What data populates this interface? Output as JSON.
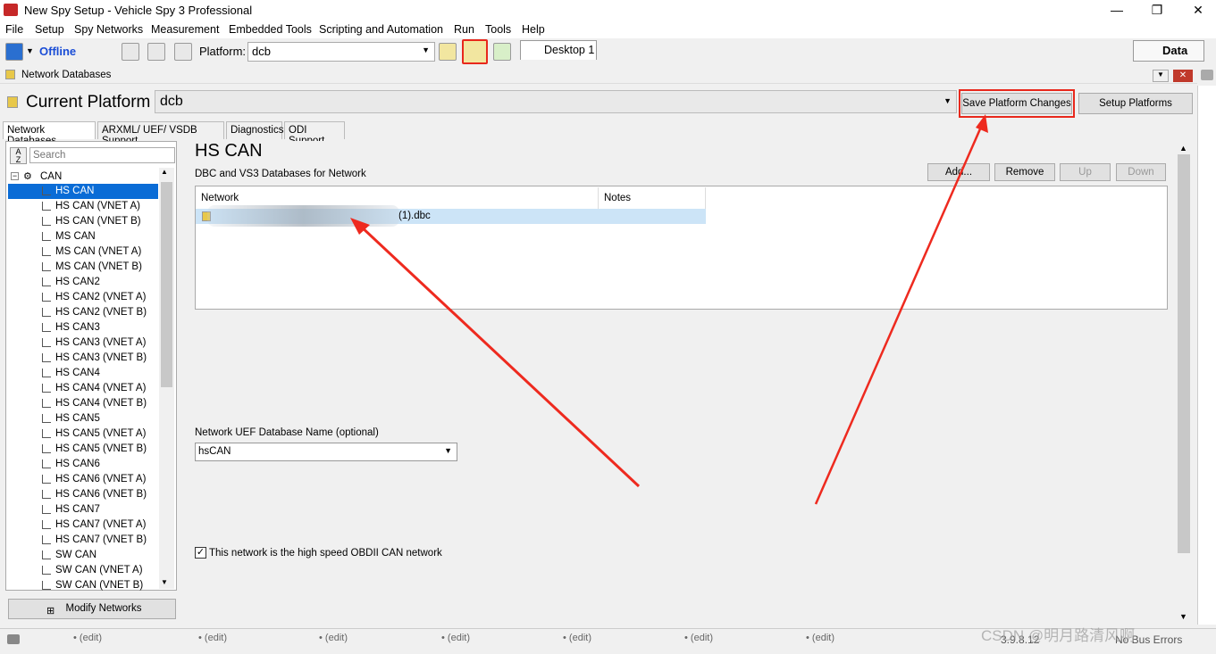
{
  "window": {
    "title": "New Spy Setup - Vehicle Spy 3 Professional",
    "minimize": "—",
    "maximize": "❐",
    "close": "✕"
  },
  "menu": [
    "File",
    "Setup",
    "Spy Networks",
    "Measurement",
    "Embedded Tools",
    "Scripting and Automation",
    "Run",
    "Tools",
    "Help"
  ],
  "toolbar": {
    "status": "Offline",
    "platform_label": "Platform:",
    "platform_value": "dcb",
    "desktop_tab": "Desktop 1",
    "data_button": "Data"
  },
  "panel": {
    "title": "Network Databases"
  },
  "current_platform": {
    "label": "Current Platform",
    "value": "dcb",
    "save_button": "Save Platform Changes",
    "setup_button": "Setup Platforms"
  },
  "tabs": [
    "Network Databases",
    "ARXML/ UEF/ VSDB Support",
    "Diagnostics",
    "ODI Support"
  ],
  "tree": {
    "search_placeholder": "Search",
    "root": "CAN",
    "items": [
      "HS CAN",
      "HS CAN (VNET A)",
      "HS CAN (VNET B)",
      "MS CAN",
      "MS CAN (VNET A)",
      "MS CAN (VNET B)",
      "HS CAN2",
      "HS CAN2 (VNET A)",
      "HS CAN2 (VNET B)",
      "HS CAN3",
      "HS CAN3 (VNET A)",
      "HS CAN3 (VNET B)",
      "HS CAN4",
      "HS CAN4 (VNET A)",
      "HS CAN4 (VNET B)",
      "HS CAN5",
      "HS CAN5 (VNET A)",
      "HS CAN5 (VNET B)",
      "HS CAN6",
      "HS CAN6 (VNET A)",
      "HS CAN6 (VNET B)",
      "HS CAN7",
      "HS CAN7 (VNET A)",
      "HS CAN7 (VNET B)",
      "SW CAN",
      "SW CAN (VNET A)",
      "SW CAN (VNET B)"
    ],
    "selected": "HS CAN",
    "modify_button": "Modify Networks"
  },
  "detail": {
    "title": "HS CAN",
    "subtitle": "DBC and VS3 Databases for Network",
    "buttons": {
      "add": "Add...",
      "remove": "Remove",
      "up": "Up",
      "down": "Down"
    },
    "columns": [
      "Network",
      "Notes"
    ],
    "rows": [
      {
        "network": "(1).dbc",
        "notes": ""
      }
    ],
    "uef_label": "Network UEF Database Name (optional)",
    "uef_value": "hsCAN",
    "obd_checked": true,
    "obd_label": "This network is the high speed OBDII CAN network"
  },
  "status": {
    "edit": "(edit)",
    "version": "3.9.8.12",
    "bus_errors": "No Bus Errors"
  },
  "watermark": "CSDN @明月路清风啊",
  "colors": {
    "selection": "#0a6cd6",
    "highlight_box": "#e8281c",
    "offline": "#1a4dd6"
  }
}
